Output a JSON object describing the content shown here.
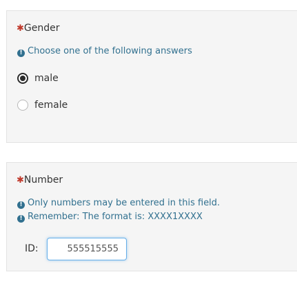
{
  "colors": {
    "panel_bg": "#f5f5f5",
    "required_marker": "#c0392b",
    "help_text": "#31708f",
    "input_focus_border": "#66afe9"
  },
  "gender_question": {
    "required_marker": "✱",
    "title": "Gender",
    "help_icon": "info-circle-icon",
    "help_text": "Choose one of the following answers",
    "options": [
      {
        "label": "male",
        "checked": true
      },
      {
        "label": "female",
        "checked": false
      }
    ]
  },
  "number_question": {
    "required_marker": "✱",
    "title": "Number",
    "help_icon": "info-circle-icon",
    "help_lines": [
      "Only numbers may be entered in this field.",
      "Remember: The format is: XXXX1XXXX"
    ],
    "id_label": "ID:",
    "id_value": "555515555"
  }
}
